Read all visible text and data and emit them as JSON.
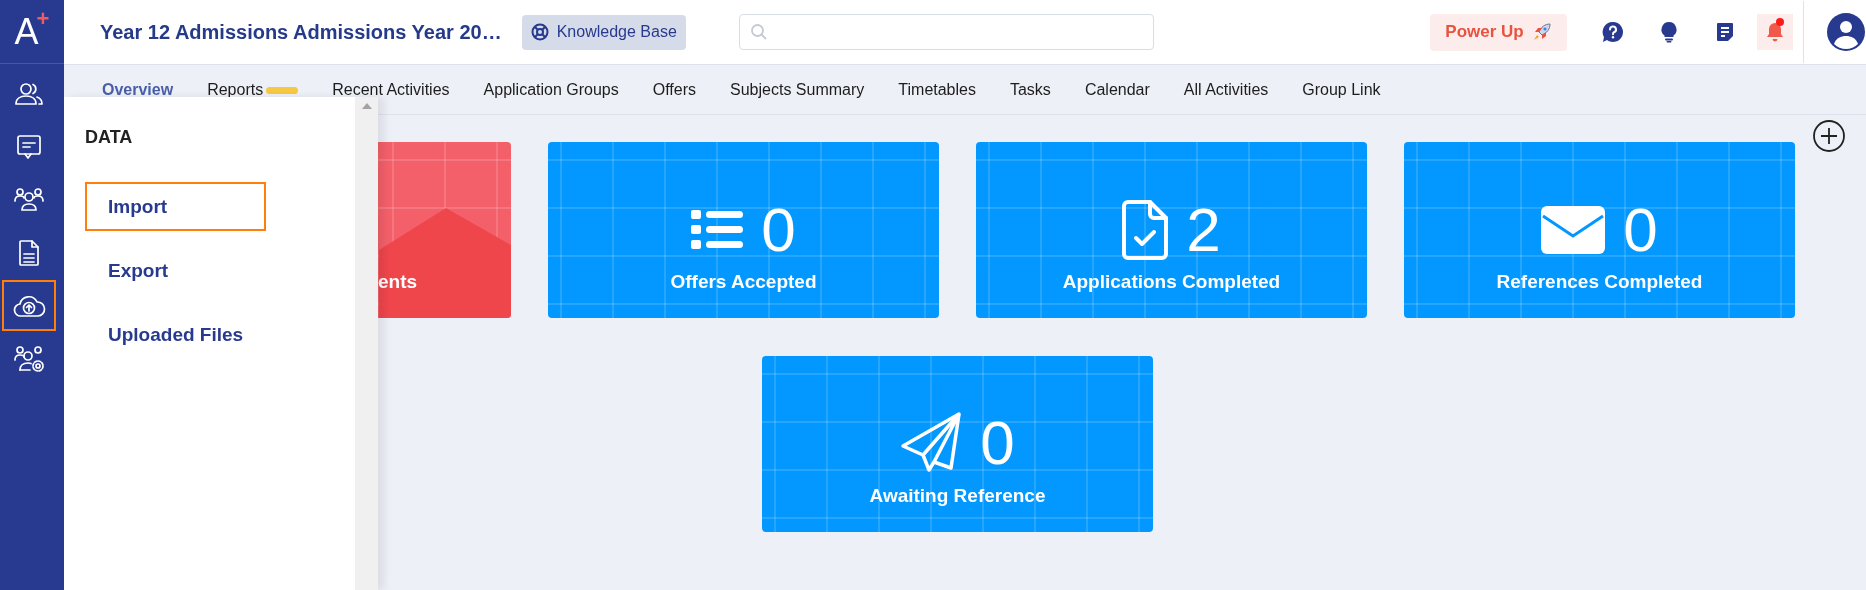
{
  "logo": {
    "letter": "A",
    "mark": "+"
  },
  "rail": [
    {
      "kind": "people",
      "selected": false
    },
    {
      "kind": "chat",
      "selected": false
    },
    {
      "kind": "group",
      "selected": false
    },
    {
      "kind": "document",
      "selected": false
    },
    {
      "kind": "upload",
      "selected": true
    },
    {
      "kind": "people-settings",
      "selected": false
    }
  ],
  "header": {
    "title": "Year 12 Admissions Admissions Year 20…",
    "knowledge_base": "Knowledge Base",
    "power_up": "Power Up",
    "notifications_unread": true
  },
  "tabs": [
    {
      "label": "Overview",
      "selected": true,
      "badge": false
    },
    {
      "label": "Reports",
      "selected": false,
      "badge": true
    },
    {
      "label": "Recent Activities",
      "selected": false,
      "badge": false
    },
    {
      "label": "Application Groups",
      "selected": false,
      "badge": false
    },
    {
      "label": "Offers",
      "selected": false,
      "badge": false
    },
    {
      "label": "Subjects Summary",
      "selected": false,
      "badge": false
    },
    {
      "label": "Timetables",
      "selected": false,
      "badge": false
    },
    {
      "label": "Tasks",
      "selected": false,
      "badge": false
    },
    {
      "label": "Calendar",
      "selected": false,
      "badge": false
    },
    {
      "label": "All Activities",
      "selected": false,
      "badge": false
    },
    {
      "label": "Group Link",
      "selected": false,
      "badge": false
    }
  ],
  "flyout": {
    "heading": "DATA",
    "items": [
      {
        "label": "Import",
        "selected": true
      },
      {
        "label": "Export",
        "selected": false
      },
      {
        "label": "Uploaded Files",
        "selected": false
      }
    ]
  },
  "cards": [
    {
      "kind": "area",
      "label": "ents",
      "color": "#f4606a"
    },
    {
      "kind": "list",
      "value": "0",
      "label": "Offers Accepted",
      "color": "#0398ff"
    },
    {
      "kind": "file-check",
      "value": "2",
      "label": "Applications Completed",
      "color": "#0398ff"
    },
    {
      "kind": "envelope",
      "value": "0",
      "label": "References Completed",
      "color": "#0398ff"
    },
    {
      "kind": "paper-plane",
      "value": "0",
      "label": "Awaiting Reference",
      "color": "#0398ff"
    }
  ]
}
